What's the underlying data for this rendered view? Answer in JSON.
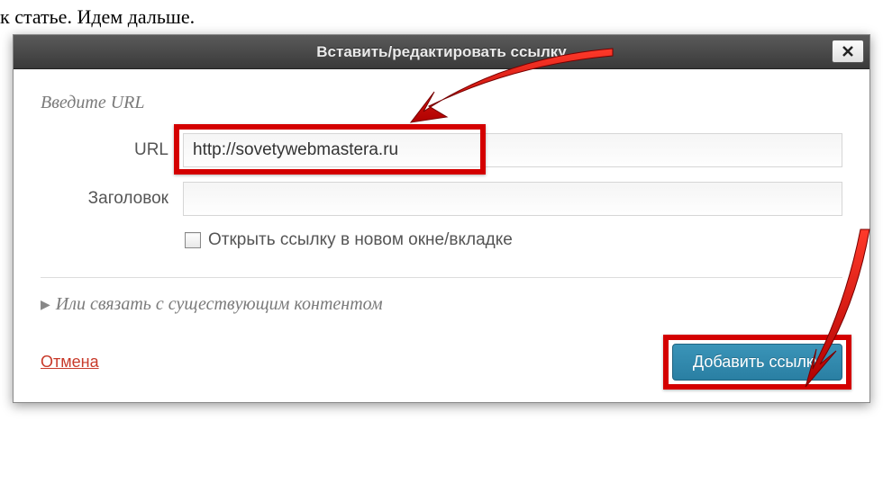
{
  "background": {
    "line1": "к статье. Идем дальше."
  },
  "dialog": {
    "title": "Вставить/редактировать ссылку",
    "section_heading": "Введите URL",
    "url_label": "URL",
    "url_value": "http://sovetywebmastera.ru",
    "title_field_label": "Заголовок",
    "title_field_value": "",
    "checkbox_label": "Открыть ссылку в новом окне/вкладке",
    "collapse_label": "Или связать с существующим контентом",
    "cancel_label": "Отмена",
    "submit_label": "Добавить ссылку"
  }
}
